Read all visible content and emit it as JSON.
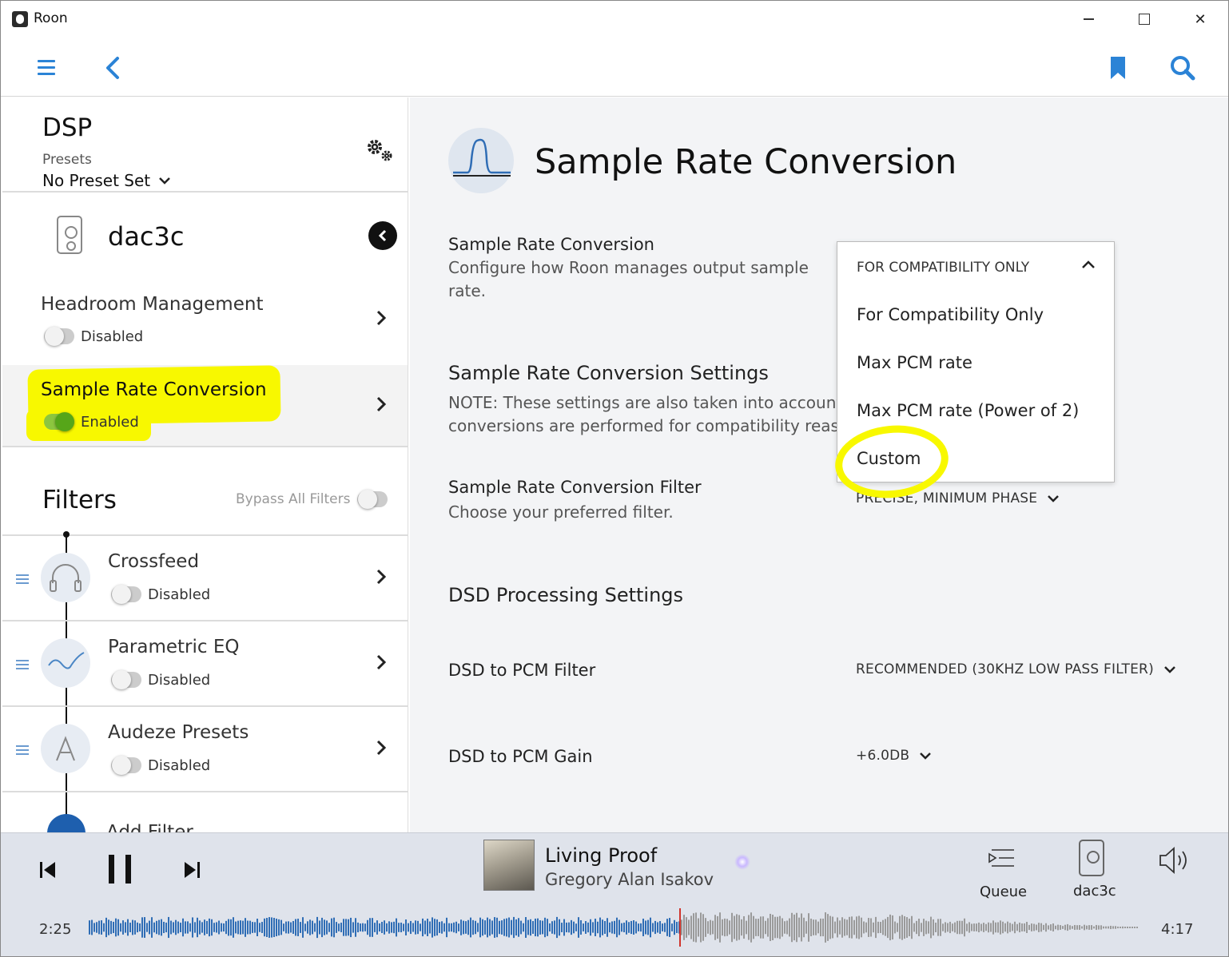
{
  "window": {
    "title": "Roon",
    "close_glyph": "✕"
  },
  "toolbar": {
    "menu_icon": "hamburger-menu-icon",
    "back_icon": "back-arrow-icon",
    "bookmark_icon": "bookmark-icon",
    "search_icon": "search-icon",
    "accent": "#2b83d6"
  },
  "sidebar": {
    "title": "DSP",
    "presets_label": "Presets",
    "preset_value": "No Preset Set",
    "zone_name": "dac3c",
    "items": [
      {
        "title": "Headroom Management",
        "status": "Disabled",
        "enabled": false
      },
      {
        "title": "Sample Rate Conversion",
        "status": "Enabled",
        "enabled": true
      }
    ],
    "filters_title": "Filters",
    "bypass_label": "Bypass All Filters",
    "filters": [
      {
        "title": "Crossfeed",
        "status": "Disabled"
      },
      {
        "title": "Parametric EQ",
        "status": "Disabled"
      },
      {
        "title": "Audeze Presets",
        "status": "Disabled"
      }
    ],
    "add_filter_label": "Add Filter"
  },
  "main": {
    "title": "Sample Rate Conversion",
    "src_label": "Sample Rate Conversion",
    "src_desc_line1": "Configure how Roon manages output sample",
    "src_desc_line2": "rate.",
    "settings_title": "Sample Rate Conversion Settings",
    "settings_note_line1": "NOTE: These settings are also taken into account",
    "settings_note_line2": "conversions are performed for compatibility reaso",
    "filter_label": "Sample Rate Conversion Filter",
    "filter_desc": "Choose your preferred filter.",
    "filter_value": "PRECISE, MINIMUM PHASE",
    "dsd_title": "DSD Processing Settings",
    "dsd_filter_label": "DSD to PCM Filter",
    "dsd_filter_value": "RECOMMENDED (30KHZ LOW PASS FILTER)",
    "dsd_gain_label": "DSD to PCM Gain",
    "dsd_gain_value": "+6.0DB"
  },
  "dropdown": {
    "selected": "FOR COMPATIBILITY ONLY",
    "options": [
      "For Compatibility Only",
      "Max PCM rate",
      "Max PCM rate (Power of 2)",
      "Custom"
    ]
  },
  "player": {
    "track": "Living Proof",
    "artist": "Gregory Alan Isakov",
    "queue_label": "Queue",
    "zone_label": "dac3c",
    "elapsed": "2:25",
    "duration": "4:17",
    "progress": 0.56,
    "played_color": "#2f6db5",
    "remaining_color": "#9a9a9a",
    "playhead_color": "#d0342c"
  },
  "highlight_color": "#f8f800"
}
